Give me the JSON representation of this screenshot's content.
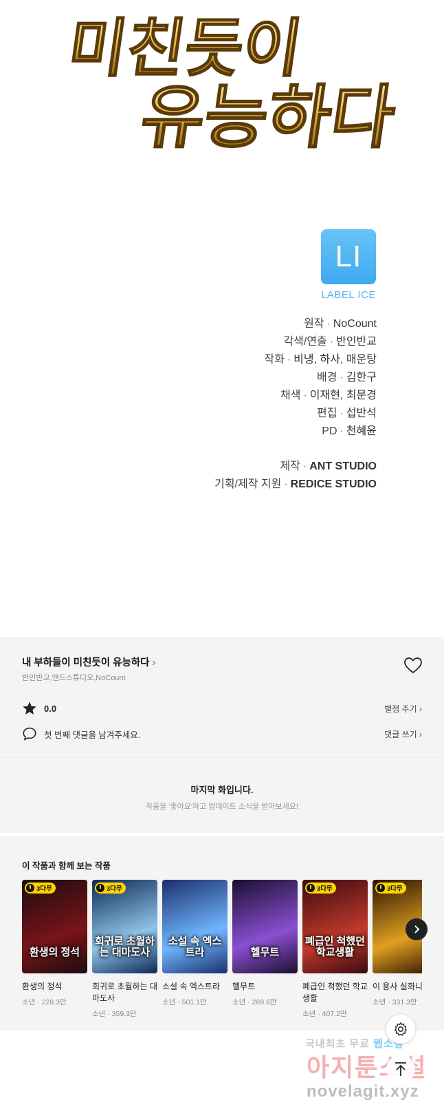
{
  "title_art": {
    "line1": "미친듯이",
    "line2": "유능하다"
  },
  "label": {
    "logo_text": "LI",
    "name": "LABEL ICE"
  },
  "credits": [
    {
      "role": "원작",
      "value": "NoCount"
    },
    {
      "role": "각색/연출",
      "value": "반인반교"
    },
    {
      "role": "작화",
      "value": "비냉, 하사, 매운탕"
    },
    {
      "role": "배경",
      "value": "김한구"
    },
    {
      "role": "채색",
      "value": "이재현, 최문경"
    },
    {
      "role": "편집",
      "value": "섭반석"
    },
    {
      "role": "PD",
      "value": "천혜윤"
    }
  ],
  "production": [
    {
      "role": "제작",
      "value": "ANT STUDIO"
    },
    {
      "role": "기획/제작 지원",
      "value": "REDICE STUDIO"
    }
  ],
  "series": {
    "title": "내 부하들이 미친듯이 유능하다",
    "authors": "반인반교,앤드스튜디오,NoCount",
    "rating": "0.0",
    "rate_link": "별점 주기",
    "comment_prompt": "첫 번째 댓글을 남겨주세요.",
    "comment_link": "댓글 쓰기"
  },
  "last_episode": {
    "title": "마지막 화입니다.",
    "subtitle": "작품을 '좋아요'하고 업데이트 소식을 받아보세요!"
  },
  "recommendations": {
    "heading": "이 작품과 함께 보는 작품",
    "items": [
      {
        "name": "환생의 정석",
        "meta": "소년 · 228.3만",
        "badge": "3다무",
        "cover_text": "환생의 정석",
        "color1": "#1a0d10",
        "color2": "#7a1418"
      },
      {
        "name": "회귀로 초월하는 대마도사",
        "meta": "소년 · 359.3만",
        "badge": "3다무",
        "cover_text": "회귀로 초월하는 대마도사",
        "color1": "#0d2a55",
        "color2": "#8fc3e8"
      },
      {
        "name": "소설 속 엑스트라",
        "meta": "소년 · 501.1만",
        "badge": "",
        "cover_text": "소설 속 엑스트라",
        "color1": "#1b2f6b",
        "color2": "#6fb6ff"
      },
      {
        "name": "헬무트",
        "meta": "소년 · 269.6만",
        "badge": "",
        "cover_text": "헬무트",
        "color1": "#1a1030",
        "color2": "#8a4fd1"
      },
      {
        "name": "폐급인 척했던 학교생활",
        "meta": "소년 · 407.2만",
        "badge": "3다무",
        "cover_text": "폐급인 척했던 학교생활",
        "color1": "#3a0c10",
        "color2": "#c0392b"
      },
      {
        "name": "이 용사 실화니",
        "meta": "소년 · 331.3만",
        "badge": "3다무",
        "cover_text": "",
        "color1": "#2a1204",
        "color2": "#e0a020"
      }
    ]
  },
  "watermark": {
    "line1_a": "국내최초 무료",
    "line1_b": "웹소설",
    "line2": "아지툰소설",
    "line3": "novelagit.xyz"
  },
  "colors": {
    "label_blue": "#3faaf0",
    "panel_bg": "#f4f4f4",
    "badge_yellow": "#ffd400"
  }
}
